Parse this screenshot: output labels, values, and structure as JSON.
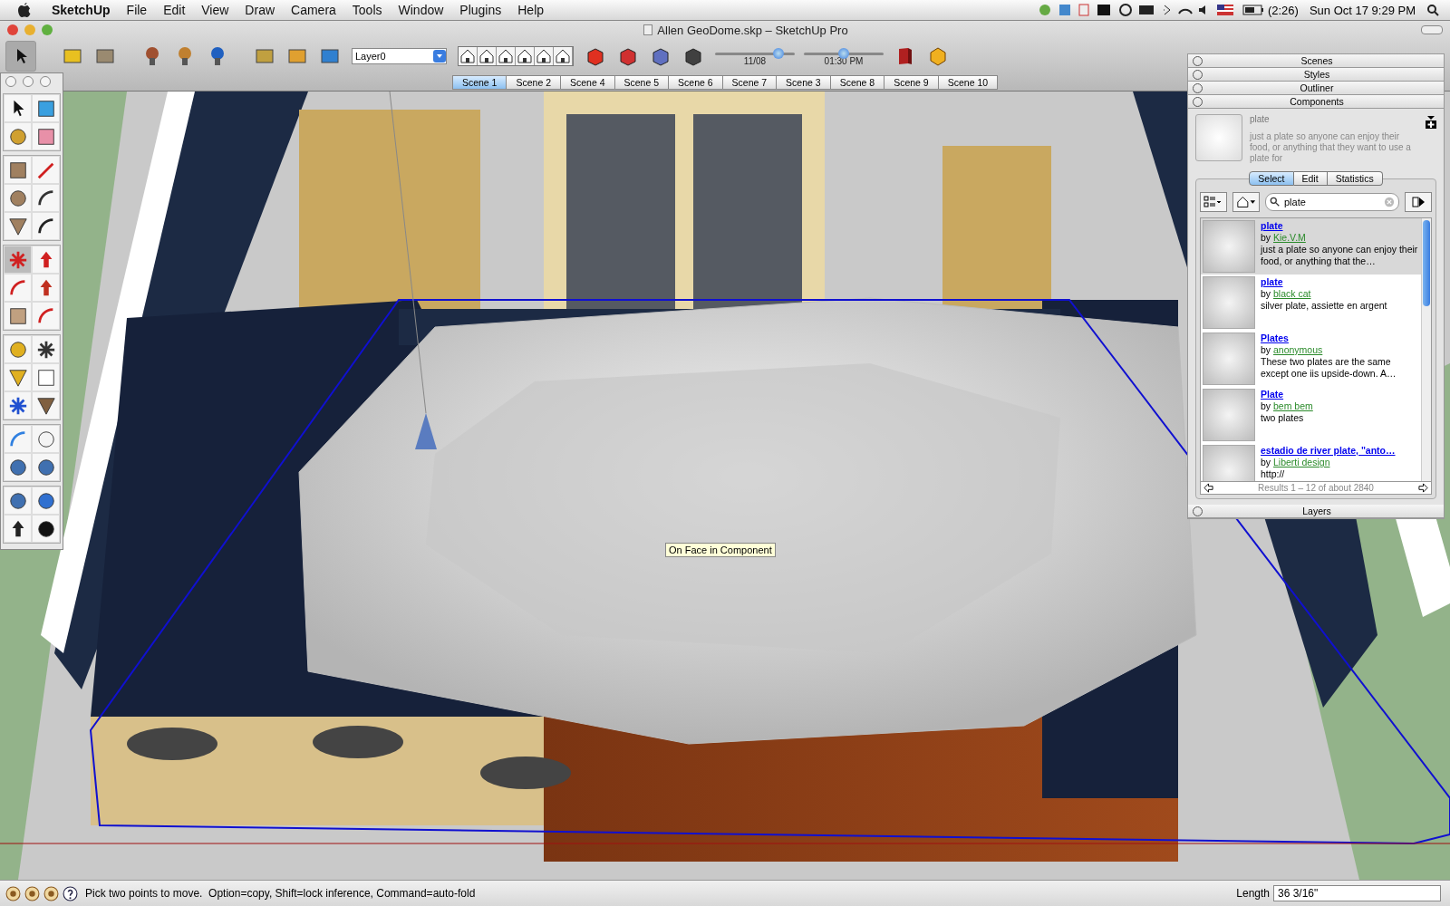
{
  "menu_bar": {
    "items": [
      "SketchUp",
      "File",
      "Edit",
      "View",
      "Draw",
      "Camera",
      "Tools",
      "Window",
      "Plugins",
      "Help"
    ],
    "battery_time": "(2:26)",
    "clock": "Sun Oct 17 9:29 PM"
  },
  "window": {
    "title": "Allen GeoDome.skp – SketchUp Pro"
  },
  "toolbar": {
    "layer": "Layer0",
    "date": {
      "label": "11/08",
      "level": 0.8
    },
    "time": {
      "label": "01:30 PM",
      "level": 0.5
    }
  },
  "scene_tabs": [
    {
      "label": "Scene 1",
      "selected": true
    },
    {
      "label": "Scene 2",
      "selected": false
    },
    {
      "label": "Scene 4",
      "selected": false
    },
    {
      "label": "Scene 5",
      "selected": false
    },
    {
      "label": "Scene 6",
      "selected": false
    },
    {
      "label": "Scene 7",
      "selected": false
    },
    {
      "label": "Scene 3",
      "selected": false
    },
    {
      "label": "Scene 8",
      "selected": false
    },
    {
      "label": "Scene 9",
      "selected": false
    },
    {
      "label": "Scene 10",
      "selected": false
    }
  ],
  "tool_palette": {
    "tools": [
      {
        "selected": false
      },
      {
        "selected": false
      },
      {
        "selected": false
      },
      {
        "selected": false
      },
      {
        "selected": false
      },
      {
        "selected": false
      },
      {
        "selected": false
      },
      {
        "selected": false
      },
      {
        "selected": false
      },
      {
        "selected": false
      },
      {
        "selected": true
      },
      {
        "selected": false
      },
      {
        "selected": false
      },
      {
        "selected": false
      },
      {
        "selected": false
      },
      {
        "selected": false
      },
      {
        "selected": false
      },
      {
        "selected": false
      },
      {
        "selected": false
      },
      {
        "selected": false
      },
      {
        "selected": false
      },
      {
        "selected": false
      },
      {
        "selected": false
      },
      {
        "selected": false
      },
      {
        "selected": false
      },
      {
        "selected": false
      },
      {
        "selected": false
      },
      {
        "selected": false
      },
      {
        "selected": false
      },
      {
        "selected": false
      }
    ]
  },
  "tooltip": "On Face in Component",
  "panel": {
    "sections_above": [
      "Scenes",
      "Styles",
      "Outliner"
    ],
    "components": {
      "title": "Components",
      "preview": {
        "name": "plate",
        "description": "just a plate so anyone can enjoy their food, or anything that they want to use a plate for"
      },
      "tabs": [
        {
          "label": "Select",
          "selected": true
        },
        {
          "label": "Edit",
          "selected": false
        },
        {
          "label": "Statistics",
          "selected": false
        }
      ],
      "search": {
        "value": "plate"
      },
      "results": [
        {
          "title": "plate",
          "author": "Kie.V.M",
          "by": "by",
          "description": "just a plate so anyone can enjoy their food, or anything that the…",
          "selected": true
        },
        {
          "title": "plate",
          "author": "black cat",
          "by": "by",
          "description": "silver plate, assiette en argent",
          "selected": false
        },
        {
          "title": "Plates",
          "author": "anonymous",
          "by": "by",
          "description": "These two plates are the same except one iis upside-down. A…",
          "selected": false
        },
        {
          "title": "Plate",
          "author": "bem bem",
          "by": "by",
          "description": "two plates",
          "selected": false
        },
        {
          "title": "estadio de river plate, \"anto…",
          "author": "Liberti design",
          "by": "by",
          "description": "http://",
          "selected": false
        }
      ],
      "footer": "Results 1 – 12 of about 2840"
    },
    "sections_below": [
      "Layers"
    ]
  },
  "status_bar": {
    "message": "Pick two points to move.  Option=copy, Shift=lock inference, Command=auto-fold",
    "measure_label": "Length",
    "measure_value": "36 3/16\""
  }
}
